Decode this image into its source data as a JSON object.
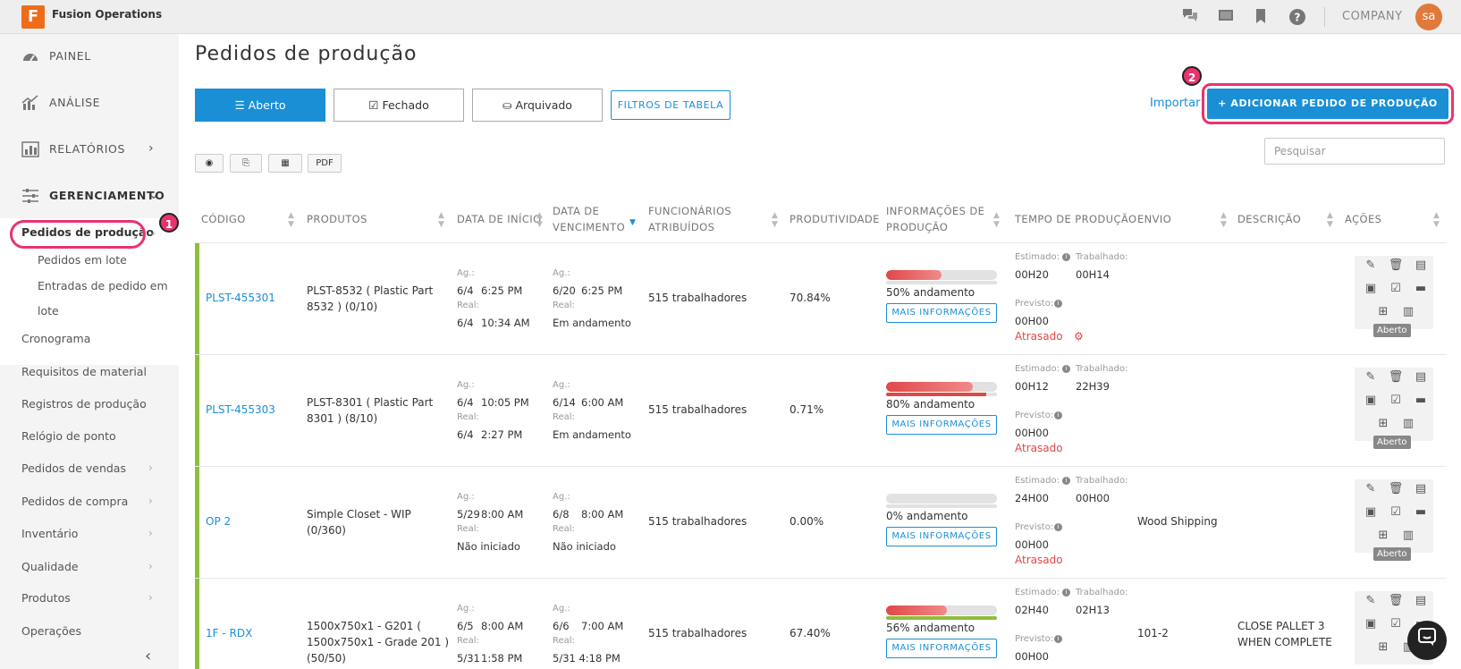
{
  "app": {
    "name": "Fusion Operations",
    "logo_letter": "F",
    "company": "COMPANY",
    "avatar": "sa"
  },
  "topbar_icons": [
    "chat-icon",
    "screen-icon",
    "bookmark-icon",
    "help-icon"
  ],
  "sidebar": {
    "top": [
      {
        "label": "PAINEL",
        "icon": "gauge-icon"
      },
      {
        "label": "ANÁLISE",
        "icon": "chart-icon"
      },
      {
        "label": "RELATÓRIOS",
        "icon": "bars-icon",
        "chevron": "›"
      },
      {
        "label": "GERENCIAMENTO",
        "icon": "sliders-icon",
        "chevron": "⌄"
      }
    ],
    "active": "Pedidos de produção",
    "sub": [
      "Pedidos em lote",
      "Entradas de pedido em",
      "lote"
    ],
    "items": [
      "Cronograma",
      "Requisitos de material",
      "Registros de produção",
      "Relógio de ponto",
      "Pedidos de vendas",
      "Pedidos de compra",
      "Inventário",
      "Qualidade",
      "Produtos",
      "Operações"
    ],
    "marker1": "1",
    "collapse": "‹"
  },
  "main": {
    "title": "Pedidos de produção",
    "tabs": [
      {
        "label": "Aberto",
        "icon": "☰"
      },
      {
        "label": "Fechado",
        "icon": "☑"
      },
      {
        "label": "Arquivado",
        "icon": "⛀"
      }
    ],
    "filters": "FILTROS DE TABELA",
    "import": "Importar",
    "add": "+ ADICIONAR PEDIDO DE PRODUÇÃO",
    "marker2": "2",
    "search_placeholder": "Pesquisar",
    "small_buttons": [
      "◉",
      "⎘",
      "▦",
      "PDF"
    ]
  },
  "table": {
    "headers": {
      "code": "CÓDIGO",
      "products": "PRODUTOS",
      "start1": "DATA DE INÍCIO",
      "due1": "DATA DE",
      "due2": "VENCIMENTO",
      "emp1": "FUNCIONÁRIOS",
      "emp2": "ATRIBUÍDOS",
      "prod": "PRODUTIVIDADE",
      "info1": "INFORMAÇÕES DE",
      "info2": "PRODUÇÃO",
      "time": "TEMPO DE PRODUÇÃO",
      "ship": "ENVIO",
      "desc": "DESCRIÇÃO",
      "actions": "AÇÕES"
    },
    "labels": {
      "ag": "Ag.:",
      "real": "Real:",
      "est": "Estimado:",
      "worked": "Trabalhado:",
      "forecast": "Previsto:",
      "more": "MAIS INFORMAÇÕES"
    },
    "rows": [
      {
        "code": "PLST-455301",
        "prod1": "PLST-8532 ( Plastic Part",
        "prod2": "8532 ) (0/10)",
        "prod3": "",
        "start_d": "6/4",
        "start_t": "6:25 PM",
        "start_real_d": "6/4",
        "start_real_t": "10:34 AM",
        "due_d": "6/20",
        "due_t": "6:25 PM",
        "due_real": "Em andamento",
        "employees": "515 trabalhadores",
        "productivity": "70.84%",
        "progress": 0.5,
        "progress_label": "50% andamento",
        "under": 0,
        "under_color": "#e2e2e2",
        "est": "00H20",
        "worked": "00H14",
        "forecast": "00H00",
        "late": "Atrasado",
        "gear": true,
        "ship": "",
        "desc1": "",
        "desc2": "",
        "status": "Aberto"
      },
      {
        "code": "PLST-455303",
        "prod1": "PLST-8301 ( Plastic Part",
        "prod2": "8301 ) (8/10)",
        "prod3": "",
        "start_d": "6/4",
        "start_t": "10:05 PM",
        "start_real_d": "6/4",
        "start_real_t": "2:27 PM",
        "due_d": "6/14",
        "due_t": "6:00 AM",
        "due_real": "Em andamento",
        "employees": "515 trabalhadores",
        "productivity": "0.71%",
        "progress": 0.78,
        "progress_label": "80% andamento",
        "under": 0.9,
        "under_color": "#e04848",
        "est": "00H12",
        "worked": "22H39",
        "forecast": "00H00",
        "late": "Atrasado",
        "gear": false,
        "ship": "",
        "desc1": "",
        "desc2": "",
        "status": "Aberto"
      },
      {
        "code": "OP 2",
        "prod1": "Simple Closet - WIP",
        "prod2": "(0/360)",
        "prod3": "",
        "start_d": "5/29",
        "start_t": "8:00 AM",
        "start_real_d": "Não iniciado",
        "start_real_t": "",
        "due_d": "6/8",
        "due_t": "8:00 AM",
        "due_real": "Não iniciado",
        "employees": "515 trabalhadores",
        "productivity": "0.00%",
        "progress": 0,
        "progress_label": "0% andamento",
        "under": 0,
        "under_color": "#e2e2e2",
        "est": "24H00",
        "worked": "00H00",
        "forecast": "00H00",
        "late": "Atrasado",
        "gear": false,
        "ship": "Wood Shipping",
        "desc1": "",
        "desc2": "",
        "status": "Aberto"
      },
      {
        "code": "1F - RDX",
        "prod1": "1500x750x1 - G201 (",
        "prod2": "1500x750x1 - Grade 201 )",
        "prod3": "(50/50)",
        "start_d": "6/5",
        "start_t": "8:00 AM",
        "start_real_d": "5/31",
        "start_real_t": "1:58 PM",
        "due_d": "6/6",
        "due_t": "7:00 AM",
        "due_real": "5/31   4:18 PM",
        "employees": "515 trabalhadores",
        "productivity": "67.40%",
        "progress": 0.55,
        "progress_label": "56% andamento",
        "under": 1.0,
        "under_color": "#8fbe3c",
        "est": "02H40",
        "worked": "02H13",
        "forecast": "00H00",
        "late": "",
        "gear": false,
        "ship": "101-2",
        "desc1": "CLOSE PALLET 3",
        "desc2": "WHEN COMPLETE",
        "status": ""
      }
    ]
  }
}
